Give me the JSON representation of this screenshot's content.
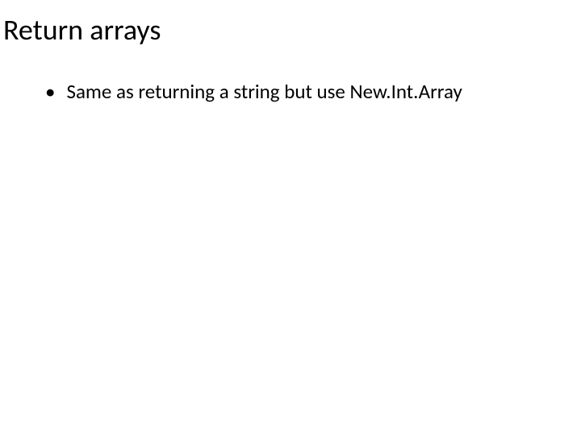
{
  "slide": {
    "title": "Return arrays",
    "bullets": [
      {
        "marker": "•",
        "text": "Same as returning a string but use New.Int.Array"
      }
    ]
  }
}
